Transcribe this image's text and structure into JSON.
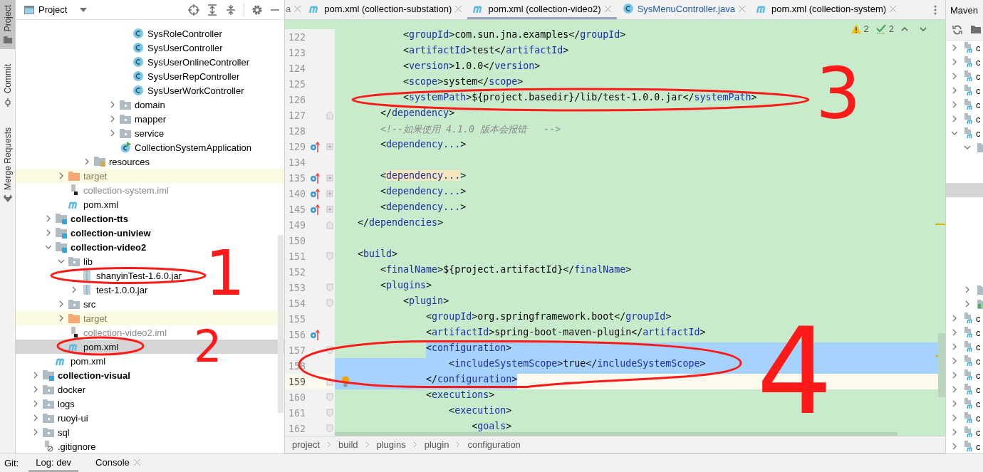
{
  "tool_strip": [
    {
      "label": "Project",
      "kind": "project",
      "selected": true
    },
    {
      "label": "Commit",
      "kind": "commit",
      "selected": false
    },
    {
      "label": "Merge Requests",
      "kind": "merge",
      "selected": false
    }
  ],
  "project": {
    "title": "Project",
    "tree": [
      {
        "children": [
          {
            "children": [
              {
                "children": [
                  {
                    "children": [
                      {
                        "children": [
                          {
                            "children": [
                              {
                                "children": [
                                  {
                                    "label": "SysRoleController",
                                    "kind": "class",
                                    "selected": false
                                  },
                                  {
                                    "label": "SysUserController",
                                    "kind": "class",
                                    "selected": false
                                  },
                                  {
                                    "label": "SysUserOnlineController",
                                    "kind": "class",
                                    "selected": false
                                  },
                                  {
                                    "label": "SysUserRepController",
                                    "kind": "class",
                                    "selected": false
                                  },
                                  {
                                    "label": "SysUserWorkController",
                                    "kind": "class",
                                    "selected": false
                                  }
                                ]
                              },
                              {
                                "label": "domain",
                                "kind": "folder",
                                "expanded": false,
                                "selected": false
                              },
                              {
                                "label": "mapper",
                                "kind": "folder",
                                "expanded": false,
                                "selected": false
                              },
                              {
                                "label": "service",
                                "kind": "folder",
                                "expanded": false,
                                "selected": false
                              },
                              {
                                "label": "CollectionSystemApplication",
                                "kind": "app",
                                "selected": false
                              }
                            ]
                          }
                        ]
                      },
                      {
                        "label": "resources",
                        "kind": "resources",
                        "expanded": false,
                        "selected": false
                      }
                    ]
                  }
                ]
              },
              {
                "label": "target",
                "kind": "excluded",
                "expanded": false,
                "selected": false
              },
              {
                "label": "collection-system.iml",
                "kind": "iml",
                "selected": false
              },
              {
                "label": "pom.xml",
                "kind": "maven",
                "selected": false
              }
            ]
          },
          {
            "label": "collection-tts",
            "kind": "module",
            "expanded": false,
            "selected": false
          },
          {
            "label": "collection-uniview",
            "kind": "module",
            "expanded": false,
            "selected": false
          },
          {
            "label": "collection-video2",
            "kind": "module",
            "expanded": true,
            "selected": false,
            "children": [
              {
                "label": "lib",
                "kind": "folder",
                "expanded": true,
                "selected": false,
                "children": [
                  {
                    "label": "shanyinTest-1.6.0.jar",
                    "kind": "jar",
                    "selected": false
                  },
                  {
                    "label": "test-1.0.0.jar",
                    "kind": "jar",
                    "expanded": false,
                    "selected": false
                  }
                ]
              },
              {
                "label": "src",
                "kind": "folder",
                "expanded": false,
                "selected": false
              },
              {
                "label": "target",
                "kind": "excluded",
                "expanded": false,
                "selected": false
              },
              {
                "label": "collection-video2.iml",
                "kind": "iml",
                "selected": false
              },
              {
                "label": "pom.xml",
                "kind": "maven",
                "selected": true
              }
            ]
          },
          {
            "label": "pom.xml",
            "kind": "maven",
            "selected": false
          }
        ]
      },
      {
        "label": "collection-visual",
        "kind": "module",
        "expanded": false,
        "selected": false
      },
      {
        "label": "docker",
        "kind": "folder",
        "expanded": false,
        "selected": false
      },
      {
        "label": "logs",
        "kind": "folder",
        "expanded": false,
        "selected": false
      },
      {
        "label": "ruoyi-ui",
        "kind": "folder",
        "expanded": false,
        "selected": false
      },
      {
        "label": "sql",
        "kind": "folder",
        "expanded": false,
        "selected": false
      },
      {
        "label": ".gitignore",
        "kind": "gitignore",
        "selected": false
      }
    ]
  },
  "editor": {
    "tabs": [
      {
        "label": "a",
        "kind": "plain",
        "selected": false
      },
      {
        "label": "pom.xml (collection-substation)",
        "kind": "maven",
        "selected": false
      },
      {
        "label": "pom.xml (collection-video2)",
        "kind": "maven",
        "selected": true
      },
      {
        "label": "SysMenuController.java",
        "kind": "class",
        "selected": false
      },
      {
        "label": "pom.xml (collection-system)",
        "kind": "maven",
        "selected": false
      }
    ],
    "inspections": [
      {
        "kind": "warning",
        "count": "2"
      },
      {
        "kind": "weak",
        "count": "2"
      }
    ],
    "lines": [
      {
        "n": "122",
        "kind": "code",
        "text": "            <groupId>com.sun.jna.examples</groupId>",
        "marked": false
      },
      {
        "n": "123",
        "kind": "code",
        "text": "            <artifactId>test</artifactId>",
        "marked": false
      },
      {
        "n": "124",
        "kind": "code",
        "text": "            <version>1.0.0</version>",
        "marked": false
      },
      {
        "n": "125",
        "kind": "code",
        "text": "            <scope>system</scope>",
        "marked": false
      },
      {
        "n": "126",
        "kind": "code",
        "text": "            <systemPath>${project.basedir}/lib/test-1.0.0.jar</systemPath>",
        "marked": false
      },
      {
        "n": "127",
        "kind": "code",
        "text": "        </dependency>",
        "marked": false
      },
      {
        "n": "128",
        "kind": "comment",
        "text": "        <!--如果使用 4.1.0 版本会报错   -->",
        "marked": false
      },
      {
        "n": "129",
        "kind": "folded",
        "text": "        <dependency...>",
        "marked": true,
        "highlighted": false
      },
      {
        "n": "134",
        "kind": "code",
        "marked": false
      },
      {
        "n": "135",
        "kind": "folded",
        "text": "        <dependency...>",
        "marked": true,
        "highlighted": true
      },
      {
        "n": "140",
        "kind": "folded",
        "text": "        <dependency...>",
        "marked": true,
        "highlighted": false
      },
      {
        "n": "145",
        "kind": "folded",
        "text": "        <dependency...>",
        "marked": true,
        "highlighted": false
      },
      {
        "n": "149",
        "kind": "code",
        "text": "    </dependencies>",
        "marked": false
      },
      {
        "n": "150",
        "kind": "code",
        "marked": false
      },
      {
        "n": "151",
        "kind": "code",
        "text": "    <build>",
        "marked": false
      },
      {
        "n": "152",
        "kind": "code",
        "text": "        <finalName>${project.artifactId}</finalName>",
        "marked": false
      },
      {
        "n": "153",
        "kind": "code",
        "text": "        <plugins>",
        "marked": false
      },
      {
        "n": "154",
        "kind": "code",
        "text": "            <plugin>",
        "marked": false
      },
      {
        "n": "155",
        "kind": "code",
        "text": "                <groupId>org.springframework.boot</groupId>",
        "marked": false
      },
      {
        "n": "156",
        "kind": "code",
        "text": "                <artifactId>spring-boot-maven-plugin</artifactId>",
        "marked": true
      },
      {
        "n": "157",
        "kind": "code",
        "text": "                <configuration>",
        "marked": false,
        "selected": true
      },
      {
        "n": "158",
        "kind": "code",
        "text": "                    <includeSystemScope>true</includeSystemScope>",
        "marked": false,
        "selected": true
      },
      {
        "n": "159",
        "kind": "code",
        "text": "                </configuration>",
        "marked": false,
        "selected": true,
        "current": true,
        "bulb": true
      },
      {
        "n": "160",
        "kind": "code",
        "text": "                <executions>",
        "marked": false
      },
      {
        "n": "161",
        "kind": "code",
        "text": "                    <execution>",
        "marked": false
      },
      {
        "n": "162",
        "kind": "code",
        "text": "                        <goals>",
        "marked": false
      }
    ],
    "breadcrumbs": [
      "project",
      "build",
      "plugins",
      "plugin",
      "configuration"
    ]
  },
  "maven": {
    "title": "Maven",
    "tree": [
      {
        "label": "c",
        "kind": "module",
        "expanded": false,
        "selected": false
      },
      {
        "label": "c",
        "kind": "module",
        "expanded": false,
        "selected": false
      },
      {
        "label": "c",
        "kind": "module",
        "expanded": false,
        "selected": false
      },
      {
        "label": "c",
        "kind": "module",
        "expanded": false,
        "selected": false
      },
      {
        "label": "c",
        "kind": "module",
        "expanded": false,
        "selected": false
      },
      {
        "label": "c",
        "kind": "module",
        "expanded": false,
        "selected": false
      },
      {
        "label": "c",
        "kind": "module",
        "expanded": true,
        "selected": false,
        "children": [
          {
            "kind": "folder",
            "expanded": true,
            "selected": false,
            "children": [
              {
                "selected": false
              },
              {
                "selected": false
              },
              {
                "selected": true
              },
              {
                "selected": false
              },
              {
                "selected": false
              },
              {
                "selected": false
              },
              {
                "selected": false
              },
              {
                "selected": false
              },
              {
                "selected": false
              }
            ]
          },
          {
            "kind": "folder",
            "expanded": false,
            "selected": false
          },
          {
            "kind": "test-folder",
            "expanded": false,
            "selected": false
          }
        ]
      },
      {
        "label": "c",
        "kind": "module",
        "expanded": false,
        "selected": false
      },
      {
        "label": "c",
        "kind": "module",
        "expanded": false,
        "selected": false
      },
      {
        "label": "c",
        "kind": "module",
        "expanded": false,
        "selected": false
      },
      {
        "label": "c",
        "kind": "module",
        "expanded": false,
        "selected": false
      },
      {
        "label": "c",
        "kind": "module",
        "expanded": false,
        "selected": false
      },
      {
        "label": "c",
        "kind": "module",
        "expanded": false,
        "selected": false
      },
      {
        "label": "c",
        "kind": "module",
        "expanded": false,
        "selected": false
      },
      {
        "label": "c",
        "kind": "module",
        "expanded": false,
        "selected": false
      },
      {
        "label": "c",
        "kind": "module",
        "expanded": false,
        "selected": false
      },
      {
        "label": "c",
        "kind": "module",
        "expanded": false,
        "selected": false
      }
    ]
  },
  "bottom_bar": {
    "label": "Git:",
    "tabs": [
      {
        "label": "Log: dev",
        "selected": true,
        "closable": false
      },
      {
        "label": "Console",
        "selected": false,
        "closable": true
      }
    ]
  },
  "annotations": [
    {
      "label": "1"
    },
    {
      "label": "2"
    },
    {
      "label": "3"
    },
    {
      "label": "4"
    }
  ]
}
